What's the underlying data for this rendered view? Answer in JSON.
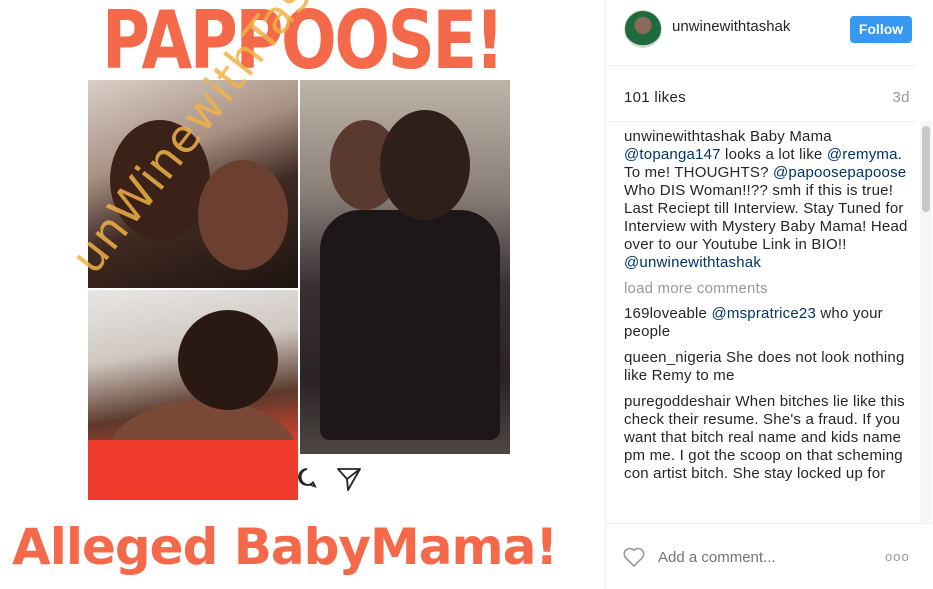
{
  "post_image": {
    "headline_top": "PAPPOOSE!",
    "headline_bottom": "Alleged BabyMama!",
    "watermark": "unWinewithTashaK"
  },
  "header": {
    "username": "unwinewithtashak",
    "follow_label": "Follow"
  },
  "stats": {
    "likes": "101 likes",
    "age": "3d"
  },
  "caption": {
    "user": "unwinewithtashak",
    "parts": [
      " Baby Mama ",
      "@topanga147",
      " looks a lot like ",
      "@remyma",
      ". To me! THOUGHTS? ",
      "@papoosepapoose",
      " Who DIS Woman!!?? smh if this is true! Last Reciept till Interview. Stay Tuned for Interview with Mystery Baby Mama! Head over to our Youtube Link in BIO!! ",
      "@unwinewithtashak"
    ]
  },
  "load_more": "load more comments",
  "comments": [
    {
      "user": "169loveable",
      "mention": "@mspratrice23",
      "text": " who your people"
    },
    {
      "user": "queen_nigeria",
      "text": " She does not look nothing like Remy to me"
    },
    {
      "user": "puregoddeshair",
      "text": " When bitches lie like this check their resume. She's a fraud. If you want that bitch real name and kids name pm me. I got the scoop on that scheming con artist bitch. She stay locked up for"
    }
  ],
  "footer": {
    "add_comment_placeholder": "Add a comment...",
    "more_label": "ooo"
  },
  "icons": {
    "heart": "heart-icon",
    "comment": "comment-icon",
    "share": "share-icon",
    "more": "more-options-icon"
  },
  "colors": {
    "headline": "#f4694a",
    "follow_button": "#3897f0",
    "mention": "#003569",
    "muted": "#999999"
  }
}
